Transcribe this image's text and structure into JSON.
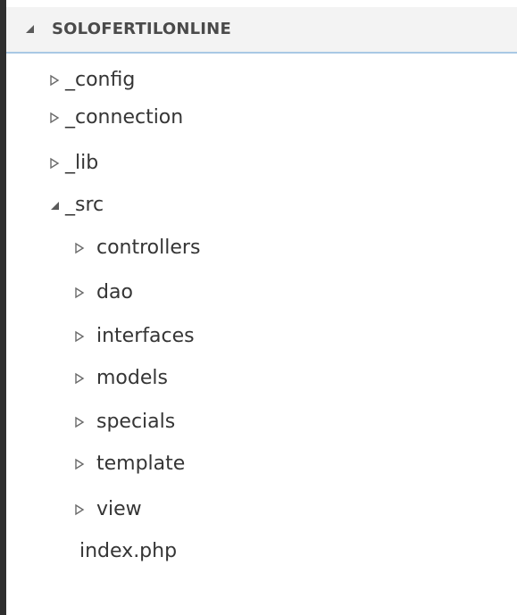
{
  "explorer": {
    "section_title": "SOLOFERTILONLINE",
    "section_state": "expanded",
    "items": [
      {
        "label": "_config",
        "type": "folder",
        "expanded": false
      },
      {
        "label": "_connection",
        "type": "folder",
        "expanded": false
      },
      {
        "label": "_lib",
        "type": "folder",
        "expanded": false
      },
      {
        "label": "_src",
        "type": "folder",
        "expanded": true
      },
      {
        "label": "controllers",
        "type": "folder",
        "expanded": false
      },
      {
        "label": "dao",
        "type": "folder",
        "expanded": false
      },
      {
        "label": "interfaces",
        "type": "folder",
        "expanded": false
      },
      {
        "label": "models",
        "type": "folder",
        "expanded": false
      },
      {
        "label": "specials",
        "type": "folder",
        "expanded": false
      },
      {
        "label": "template",
        "type": "folder",
        "expanded": false
      },
      {
        "label": "view",
        "type": "folder",
        "expanded": false
      },
      {
        "label": "index.php",
        "type": "file"
      }
    ]
  },
  "icons": {
    "collapsed": "chevron-right-outline-icon",
    "expanded": "chevron-down-filled-icon"
  },
  "colors": {
    "header_bg": "#f3f3f3",
    "header_rule": "#a9c8e4",
    "text": "#353535",
    "left_rule": "#2f2f2f"
  }
}
